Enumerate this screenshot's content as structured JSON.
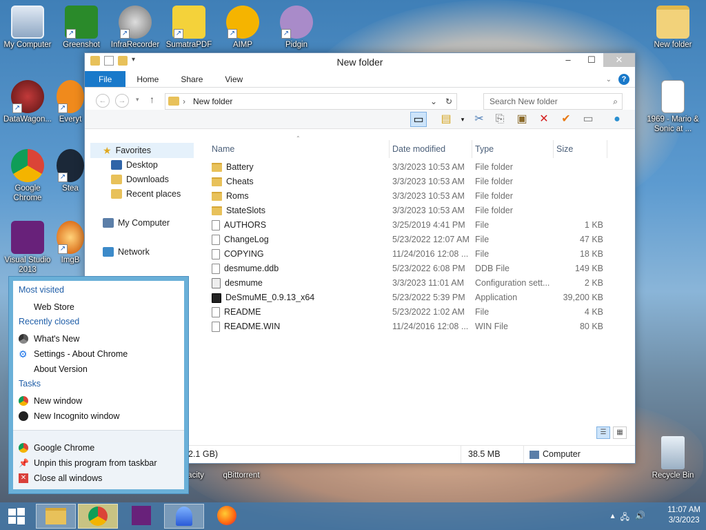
{
  "desktop": {
    "icons": [
      {
        "label": "My Computer"
      },
      {
        "label": "Greenshot"
      },
      {
        "label": "InfraRecorder"
      },
      {
        "label": "SumatraPDF"
      },
      {
        "label": "AIMP"
      },
      {
        "label": "Pidgin"
      },
      {
        "label": "New folder"
      },
      {
        "label": "DataWagon..."
      },
      {
        "label": "Everyt"
      },
      {
        "label": "1969 - Mario & Sonic at ..."
      },
      {
        "label": "Google Chrome"
      },
      {
        "label": "Stea"
      },
      {
        "label": "Visual Studio 2013"
      },
      {
        "label": "ImgB"
      },
      {
        "label": "Recycle Bin"
      },
      {
        "label": "acity"
      },
      {
        "label": "qBittorrent"
      }
    ]
  },
  "explorer": {
    "title": "New folder",
    "tabs": [
      "File",
      "Home",
      "Share",
      "View"
    ],
    "address": {
      "path": "New folder"
    },
    "search": {
      "placeholder": "Search New folder"
    },
    "nav": {
      "favorites": "Favorites",
      "desktop": "Desktop",
      "downloads": "Downloads",
      "recent": "Recent places",
      "computer": "My Computer",
      "network": "Network"
    },
    "columns": {
      "name": "Name",
      "date": "Date modified",
      "type": "Type",
      "size": "Size"
    },
    "files": [
      {
        "name": "Battery",
        "date": "3/3/2023 10:53 AM",
        "type": "File folder",
        "size": "",
        "icon": "folder"
      },
      {
        "name": "Cheats",
        "date": "3/3/2023 10:53 AM",
        "type": "File folder",
        "size": "",
        "icon": "folder"
      },
      {
        "name": "Roms",
        "date": "3/3/2023 10:53 AM",
        "type": "File folder",
        "size": "",
        "icon": "folder"
      },
      {
        "name": "StateSlots",
        "date": "3/3/2023 10:53 AM",
        "type": "File folder",
        "size": "",
        "icon": "folder"
      },
      {
        "name": "AUTHORS",
        "date": "3/25/2019 4:41 PM",
        "type": "File",
        "size": "1 KB",
        "icon": "file"
      },
      {
        "name": "ChangeLog",
        "date": "5/23/2022 12:07 AM",
        "type": "File",
        "size": "47 KB",
        "icon": "file"
      },
      {
        "name": "COPYING",
        "date": "11/24/2016 12:08 ...",
        "type": "File",
        "size": "18 KB",
        "icon": "file"
      },
      {
        "name": "desmume.ddb",
        "date": "5/23/2022 6:08 PM",
        "type": "DDB File",
        "size": "149 KB",
        "icon": "file"
      },
      {
        "name": "desmume",
        "date": "3/3/2023 11:01 AM",
        "type": "Configuration sett...",
        "size": "2 KB",
        "icon": "cfg"
      },
      {
        "name": "DeSmuME_0.9.13_x64",
        "date": "5/23/2022 5:39 PM",
        "type": "Application",
        "size": "39,200 KB",
        "icon": "app"
      },
      {
        "name": "README",
        "date": "5/23/2022 1:02 AM",
        "type": "File",
        "size": "4 KB",
        "icon": "file"
      },
      {
        "name": "README.WIN",
        "date": "11/24/2016 12:08 ...",
        "type": "WIN File",
        "size": "80 KB",
        "icon": "file"
      }
    ],
    "status": {
      "left": "2.1 GB)",
      "size": "38.5 MB",
      "location": "Computer"
    }
  },
  "jumplist": {
    "most_visited": "Most visited",
    "web_store": "Web Store",
    "recently_closed": "Recently closed",
    "whats_new": "What's New",
    "settings": "Settings - About Chrome",
    "about_version": "About Version",
    "tasks": "Tasks",
    "new_window": "New window",
    "new_incognito": "New Incognito window",
    "app_name": "Google Chrome",
    "unpin": "Unpin this program from taskbar",
    "close_all": "Close all windows"
  },
  "taskbar": {
    "time": "11:07 AM",
    "date": "3/3/2023"
  },
  "colors": {
    "accent": "#1979ca",
    "jump_header": "#1f5ea8",
    "folder": "#e8c15a"
  }
}
